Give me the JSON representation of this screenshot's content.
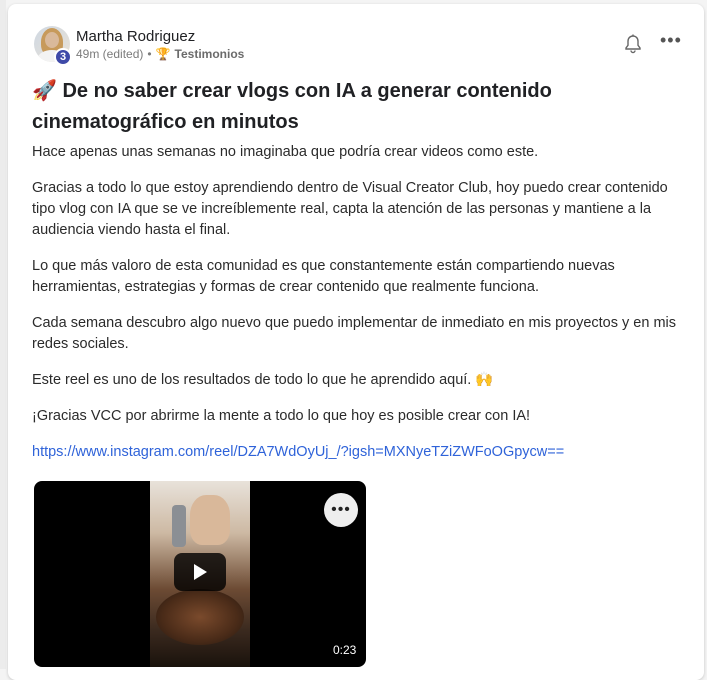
{
  "post": {
    "author": "Martha Rodriguez",
    "level": "3",
    "time": "49m (edited)",
    "separator": "•",
    "category": "Testimonios",
    "title": "🚀 De no saber crear vlogs con IA a generar contenido cinematográfico en minutos",
    "paragraphs": [
      "Hace apenas unas semanas no imaginaba que podría crear videos como este.",
      "Gracias a todo lo que estoy aprendiendo dentro de Visual Creator Club, hoy puedo crear contenido tipo vlog con IA que se ve increíblemente real, capta la atención de las personas y mantiene a la audiencia viendo hasta el final.",
      "Lo que más valoro de esta comunidad es que constantemente están compartiendo nuevas herramientas, estrategias y formas de crear contenido que realmente funciona.",
      "Cada semana descubro algo nuevo que puedo implementar de inmediato en mis proyectos y en mis redes sociales.",
      "Este reel es uno de los resultados de todo lo que he aprendido aquí. 🙌",
      "¡Gracias VCC por abrirme la mente a todo lo que hoy es posible crear con IA!"
    ],
    "link": "https://www.instagram.com/reel/DZA7WdOyUj_/?igsh=MXNyeTZiZWFoOGpycw==",
    "video": {
      "duration": "0:23",
      "more_label": "•••"
    },
    "more_label": "•••"
  },
  "colors": {
    "link": "#2f63d9",
    "badge": "#3f4aa8"
  },
  "icons": {
    "bell": "bell-icon",
    "trophy": "trophy-icon",
    "play": "play-icon"
  }
}
